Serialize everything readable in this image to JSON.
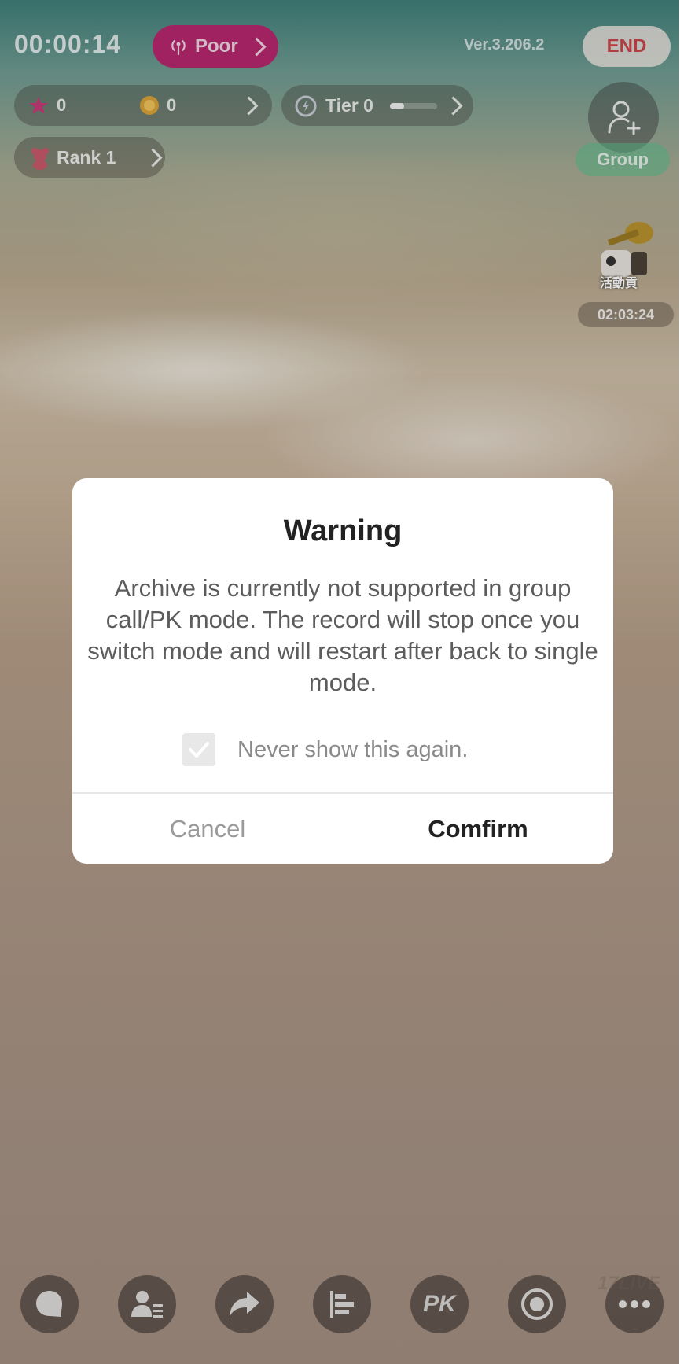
{
  "status": {
    "timer": "00:00:14",
    "signal": "Poor",
    "version": "Ver.3.206.2",
    "end_label": "END"
  },
  "stats": {
    "points": "0",
    "coins": "0",
    "tier": "Tier 0",
    "rank": "Rank 1"
  },
  "side": {
    "group_label": "Group",
    "event_badge": "活動貢",
    "event_timer": "02:03:24"
  },
  "dialog": {
    "title": "Warning",
    "message": "Archive is currently not supported in group call/PK mode. The record will stop once you switch mode and will restart after back to single mode.",
    "checkbox_label": "Never show this again.",
    "checkbox_checked": true,
    "cancel_label": "Cancel",
    "confirm_label": "Comfirm"
  },
  "toolbar": {
    "pk_label": "PK",
    "watermark": "17LIVE"
  },
  "colors": {
    "signal_pill": "#b8276e",
    "end_text": "#c9464a",
    "group_pill": "#5abe8c"
  },
  "icons": [
    "signal-icon",
    "star-icon",
    "coin-icon",
    "tier-icon",
    "rank-bear-icon",
    "add-user-icon",
    "event-trumpet-icon",
    "check-icon",
    "chat-icon",
    "viewer-list-icon",
    "share-icon",
    "ranking-icon",
    "pk-icon",
    "record-icon",
    "more-icon"
  ]
}
